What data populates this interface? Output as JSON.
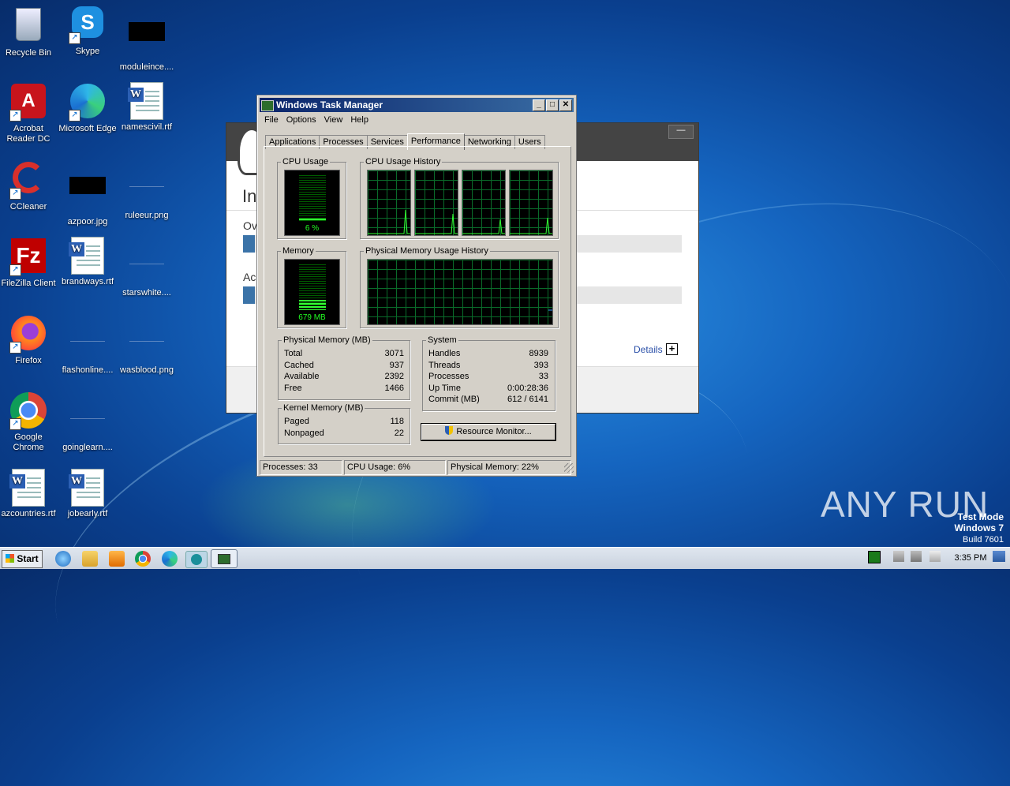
{
  "desktop": {
    "icons": [
      {
        "label": "Recycle Bin"
      },
      {
        "label": "Skype"
      },
      {
        "label": "moduleince...."
      },
      {
        "label": "Acrobat Reader DC"
      },
      {
        "label": "Microsoft Edge"
      },
      {
        "label": "namescivil.rtf"
      },
      {
        "label": "CCleaner"
      },
      {
        "label": "azpoor.jpg"
      },
      {
        "label": "ruleeur.png"
      },
      {
        "label": "FileZilla Client"
      },
      {
        "label": "brandways.rtf"
      },
      {
        "label": "starswhite...."
      },
      {
        "label": "Firefox"
      },
      {
        "label": "flashonline...."
      },
      {
        "label": "wasblood.png"
      },
      {
        "label": "Google Chrome"
      },
      {
        "label": "goinglearn...."
      },
      {
        "label": "azcountries.rtf"
      },
      {
        "label": "jobearly.rtf"
      }
    ]
  },
  "bg_window": {
    "title_frag": "In",
    "row1": "Ov",
    "row2": "Ac",
    "details": "Details"
  },
  "task_manager": {
    "title": "Windows Task Manager",
    "menu": [
      "File",
      "Options",
      "View",
      "Help"
    ],
    "tabs": [
      "Applications",
      "Processes",
      "Services",
      "Performance",
      "Networking",
      "Users"
    ],
    "active_tab": "Performance",
    "cpu_usage": {
      "title": "CPU Usage",
      "value": "6 %",
      "percent": 6
    },
    "cpu_history": {
      "title": "CPU Usage History"
    },
    "memory": {
      "title": "Memory",
      "value": "679 MB",
      "fraction": 0.22
    },
    "mem_history": {
      "title": "Physical Memory Usage History"
    },
    "physical_memory": {
      "title": "Physical Memory (MB)",
      "rows": [
        {
          "label": "Total",
          "value": "3071"
        },
        {
          "label": "Cached",
          "value": "937"
        },
        {
          "label": "Available",
          "value": "2392"
        },
        {
          "label": "Free",
          "value": "1466"
        }
      ]
    },
    "kernel_memory": {
      "title": "Kernel Memory (MB)",
      "rows": [
        {
          "label": "Paged",
          "value": "118"
        },
        {
          "label": "Nonpaged",
          "value": "22"
        }
      ]
    },
    "system": {
      "title": "System",
      "rows": [
        {
          "label": "Handles",
          "value": "8939"
        },
        {
          "label": "Threads",
          "value": "393"
        },
        {
          "label": "Processes",
          "value": "33"
        },
        {
          "label": "Up Time",
          "value": "0:00:28:36"
        },
        {
          "label": "Commit (MB)",
          "value": "612 / 6141"
        }
      ]
    },
    "resource_monitor_button": "Resource Monitor...",
    "status": {
      "processes": "Processes: 33",
      "cpu": "CPU Usage: 6%",
      "memory": "Physical Memory: 22%"
    }
  },
  "taskbar": {
    "start_label": "Start",
    "clock": "3:35 PM"
  },
  "watermark": {
    "brand": "ANY RUN",
    "line1": "Test Mode",
    "line2": "Windows 7",
    "line3": "Build 7601"
  }
}
